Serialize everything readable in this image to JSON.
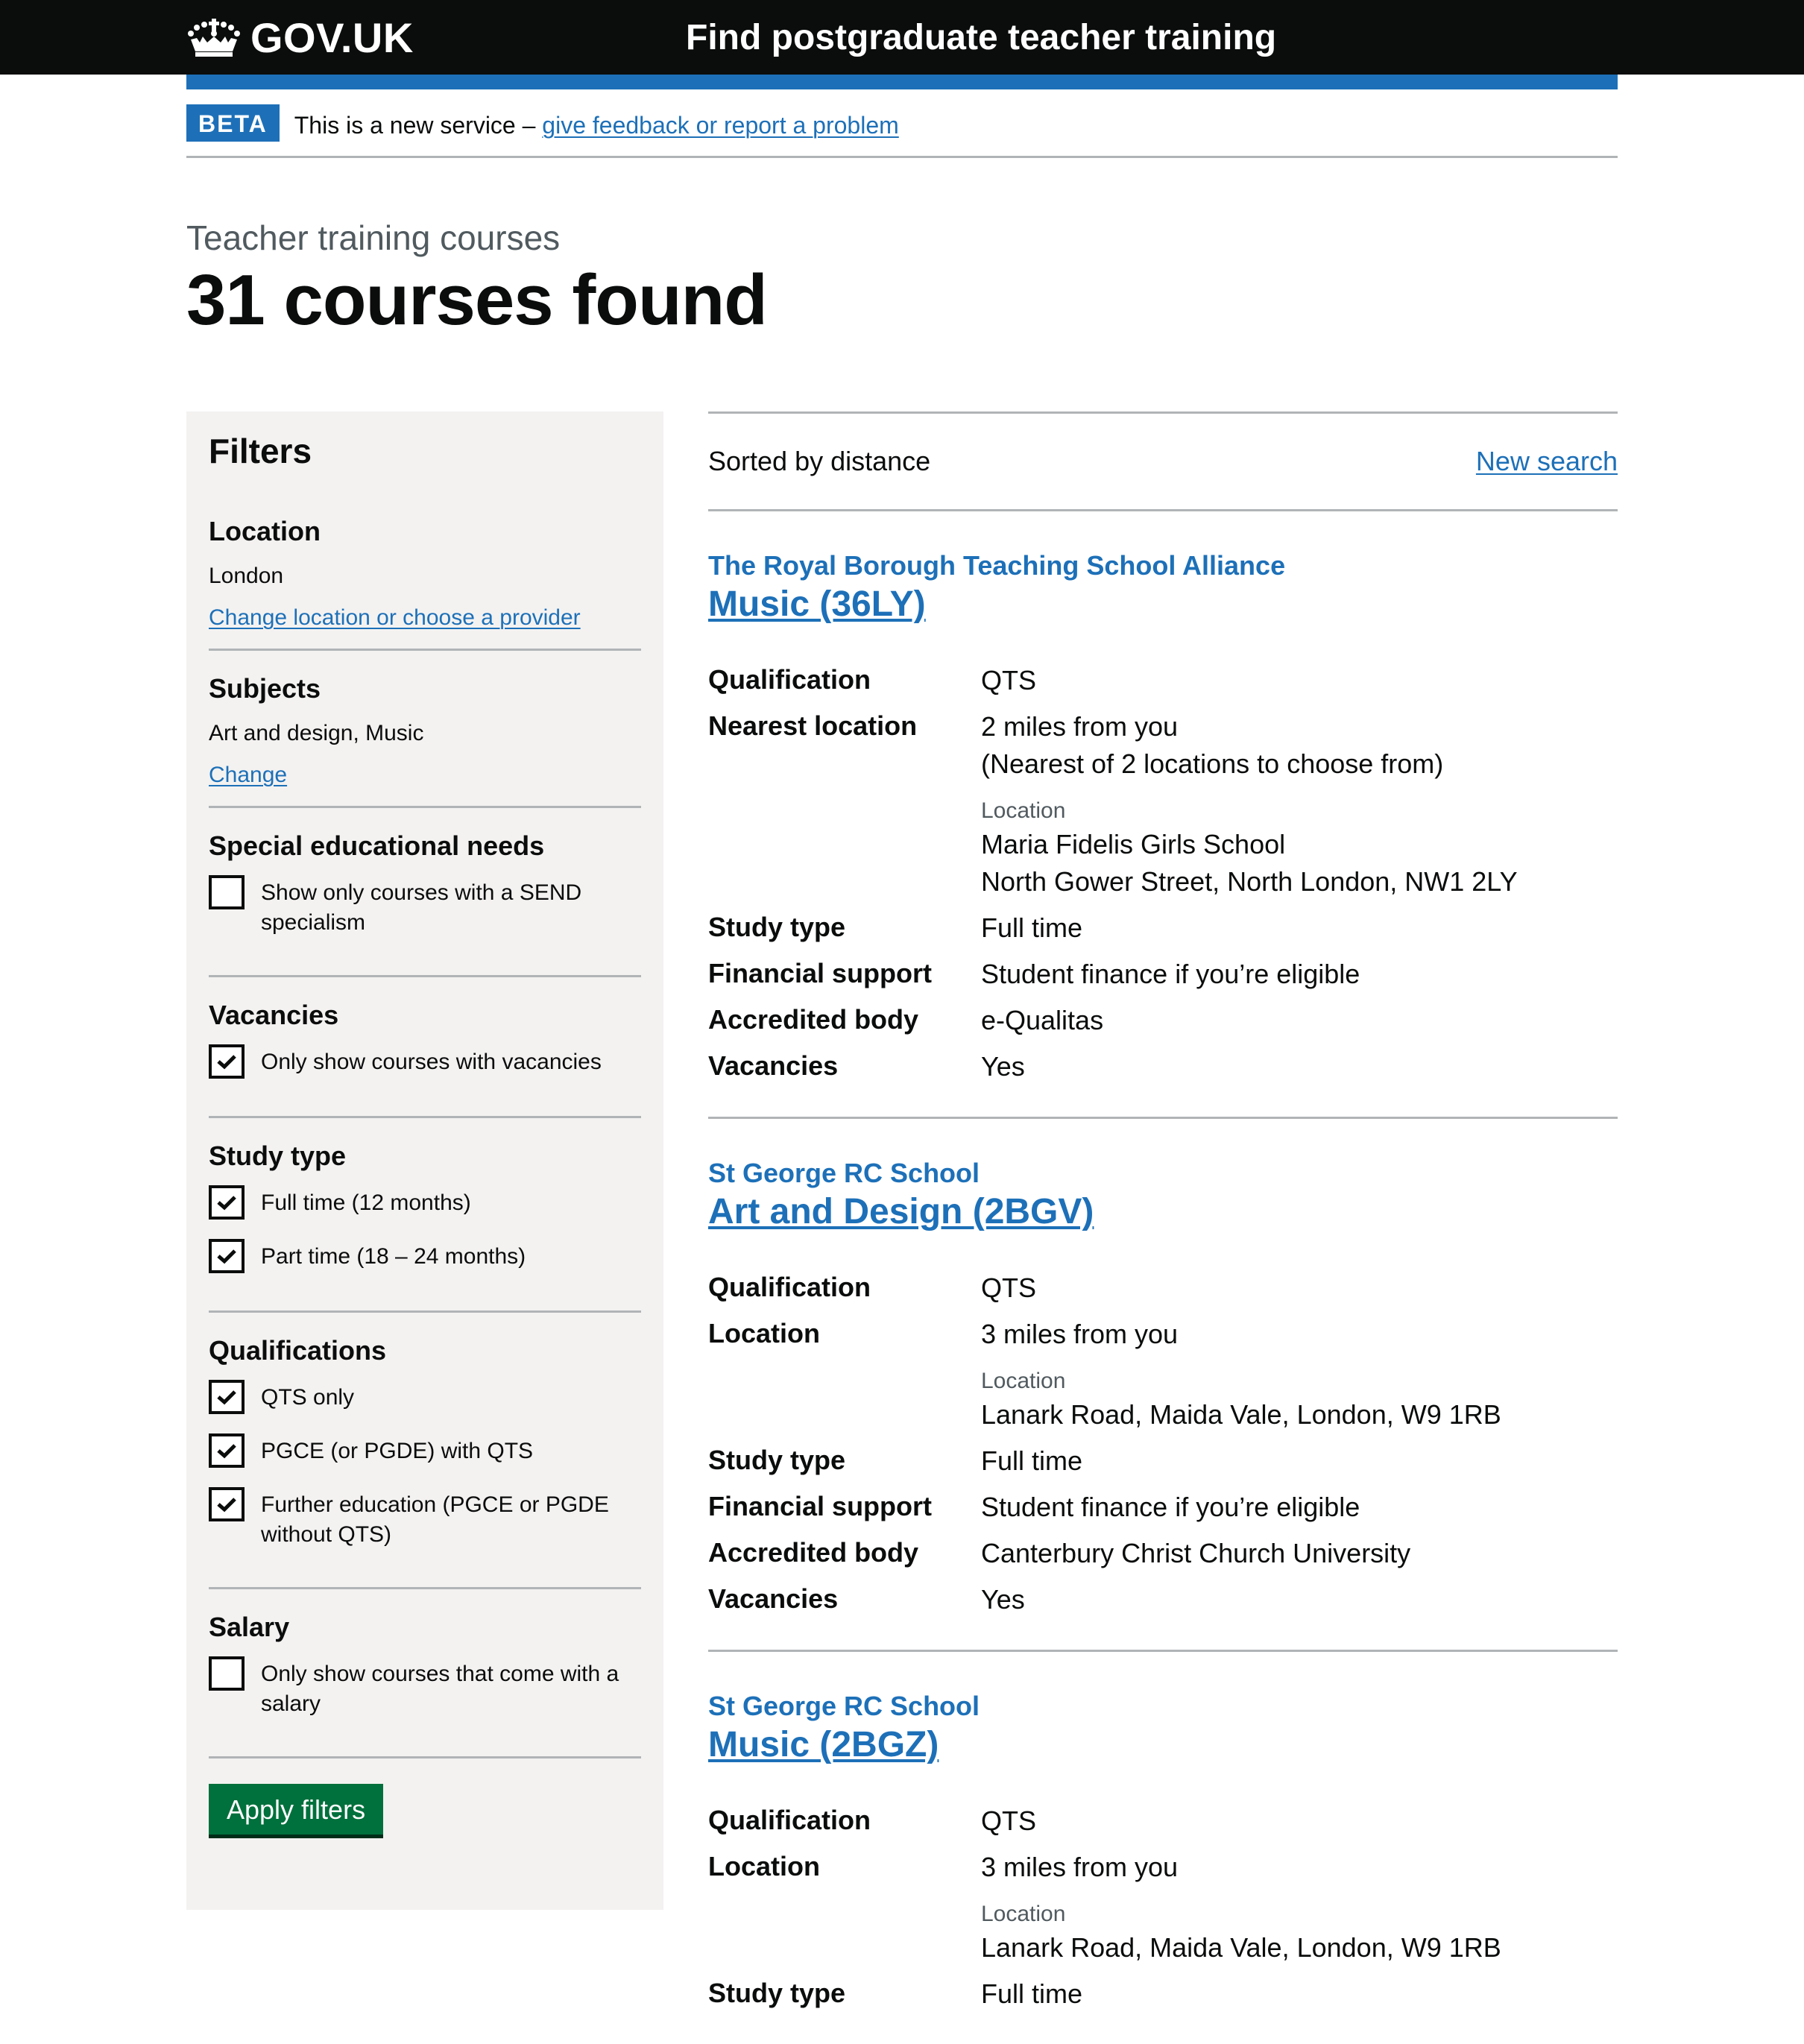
{
  "header": {
    "logo_text": "GOV.UK",
    "logo_icon": "crown-icon",
    "service_name": "Find postgraduate teacher training"
  },
  "phase_banner": {
    "tag": "BETA",
    "text": "This is a new service – ",
    "link": "give feedback or report a problem"
  },
  "page": {
    "caption": "Teacher training courses",
    "title": "31 courses found"
  },
  "filters": {
    "title": "Filters",
    "location": {
      "heading": "Location",
      "value": "London",
      "change_link": "Change location or choose a provider"
    },
    "subjects": {
      "heading": "Subjects",
      "value": "Art and design, Music",
      "change_link": "Change"
    },
    "send": {
      "heading": "Special educational needs",
      "options": [
        {
          "label": "Show only courses with a SEND specialism",
          "checked": false
        }
      ]
    },
    "vacancies": {
      "heading": "Vacancies",
      "options": [
        {
          "label": "Only show courses with vacancies",
          "checked": true
        }
      ]
    },
    "study_type": {
      "heading": "Study type",
      "options": [
        {
          "label": "Full time (12 months)",
          "checked": true
        },
        {
          "label": "Part time (18 – 24 months)",
          "checked": true
        }
      ]
    },
    "qualifications": {
      "heading": "Qualifications",
      "options": [
        {
          "label": "QTS only",
          "checked": true
        },
        {
          "label": "PGCE (or PGDE) with QTS",
          "checked": true
        },
        {
          "label": "Further education (PGCE or PGDE without QTS)",
          "checked": true
        }
      ]
    },
    "salary": {
      "heading": "Salary",
      "options": [
        {
          "label": "Only show courses that come with a salary",
          "checked": false
        }
      ]
    },
    "apply_button": "Apply filters"
  },
  "results": {
    "sorted_by": "Sorted by distance",
    "new_search": "New search",
    "location_sublabel": "Location",
    "courses": [
      {
        "provider": "The Royal Borough Teaching School Alliance",
        "title": "Music (36LY)",
        "rows": {
          "qualification": {
            "label": "Qualification",
            "value": "QTS"
          },
          "location": {
            "label": "Nearest location",
            "value": "2 miles from you",
            "extra": "(Nearest of 2 locations to choose from)",
            "name": "Maria Fidelis Girls School",
            "address": "North Gower Street, North London, NW1 2LY"
          },
          "study_type": {
            "label": "Study type",
            "value": "Full time"
          },
          "financial_support": {
            "label": "Financial support",
            "value": "Student finance if you’re eligible"
          },
          "accredited_body": {
            "label": "Accredited body",
            "value": "e-Qualitas"
          },
          "vacancies": {
            "label": "Vacancies",
            "value": "Yes"
          }
        }
      },
      {
        "provider": "St George RC School",
        "title": "Art and Design (2BGV)",
        "rows": {
          "qualification": {
            "label": "Qualification",
            "value": "QTS"
          },
          "location": {
            "label": "Location",
            "value": "3 miles from you",
            "address": "Lanark Road, Maida Vale, London, W9 1RB"
          },
          "study_type": {
            "label": "Study type",
            "value": "Full time"
          },
          "financial_support": {
            "label": "Financial support",
            "value": "Student finance if you’re eligible"
          },
          "accredited_body": {
            "label": "Accredited body",
            "value": "Canterbury Christ Church University"
          },
          "vacancies": {
            "label": "Vacancies",
            "value": "Yes"
          }
        }
      },
      {
        "provider": "St George RC School",
        "title": "Music (2BGZ)",
        "rows": {
          "qualification": {
            "label": "Qualification",
            "value": "QTS"
          },
          "location": {
            "label": "Location",
            "value": "3 miles from you",
            "address": "Lanark Road, Maida Vale, London, W9 1RB"
          },
          "study_type": {
            "label": "Study type",
            "value": "Full time"
          }
        }
      }
    ]
  },
  "colors": {
    "header_bg": "#0b0c0c",
    "brand_blue": "#1d70b8",
    "sidebar_bg": "#f3f2f1",
    "button_green": "#00703c",
    "border_grey": "#b1b4b6",
    "secondary_text": "#505a5f"
  }
}
